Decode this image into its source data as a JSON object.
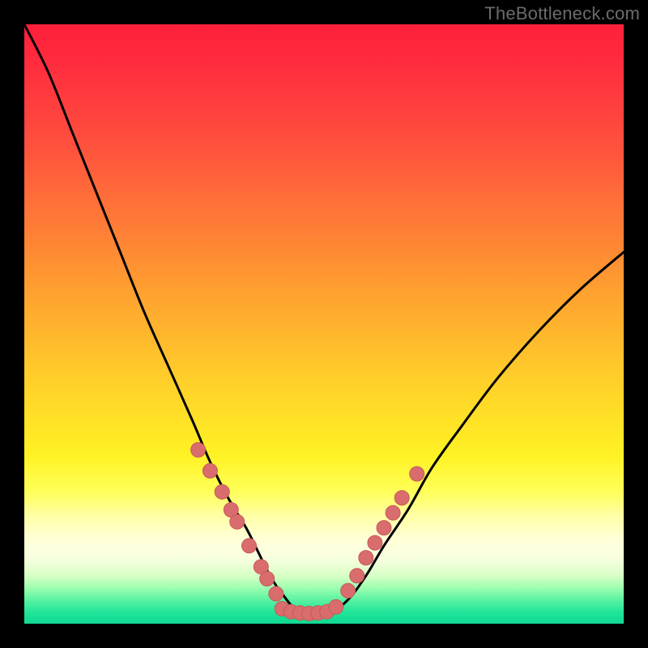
{
  "watermark": "TheBottleneck.com",
  "colors": {
    "curve": "#000000",
    "marker_fill": "#d96c6c",
    "marker_stroke": "#c85a5a"
  },
  "chart_data": {
    "type": "line",
    "title": "",
    "xlabel": "",
    "ylabel": "",
    "xlim": [
      0,
      100
    ],
    "ylim": [
      0,
      100
    ],
    "grid": false,
    "legend": false,
    "annotations": [
      {
        "text": "TheBottleneck.com",
        "pos": "top-right"
      }
    ],
    "series": [
      {
        "name": "curve",
        "x": [
          0,
          4,
          8,
          12,
          16,
          20,
          24,
          28,
          31,
          34,
          37,
          39,
          41,
          43,
          46,
          51,
          54,
          57,
          60,
          64,
          68,
          73,
          79,
          86,
          93,
          100
        ],
        "y": [
          100,
          92,
          82,
          72,
          62,
          52,
          43,
          34,
          27,
          21,
          16,
          12,
          8,
          5,
          2,
          2,
          4,
          8,
          13,
          19,
          26,
          33,
          41,
          49,
          56,
          62
        ]
      }
    ],
    "markers": [
      {
        "x": 29.0,
        "y": 29.0
      },
      {
        "x": 31.0,
        "y": 25.5
      },
      {
        "x": 33.0,
        "y": 22.0
      },
      {
        "x": 34.5,
        "y": 19.0
      },
      {
        "x": 35.5,
        "y": 17.0
      },
      {
        "x": 37.5,
        "y": 13.0
      },
      {
        "x": 39.5,
        "y": 9.5
      },
      {
        "x": 40.5,
        "y": 7.5
      },
      {
        "x": 42.0,
        "y": 5.0
      },
      {
        "x": 43.0,
        "y": 2.5
      },
      {
        "x": 44.5,
        "y": 2.0
      },
      {
        "x": 46.0,
        "y": 1.8
      },
      {
        "x": 47.5,
        "y": 1.7
      },
      {
        "x": 49.0,
        "y": 1.8
      },
      {
        "x": 50.5,
        "y": 2.0
      },
      {
        "x": 52.0,
        "y": 2.8
      },
      {
        "x": 54.0,
        "y": 5.5
      },
      {
        "x": 55.5,
        "y": 8.0
      },
      {
        "x": 57.0,
        "y": 11.0
      },
      {
        "x": 58.5,
        "y": 13.5
      },
      {
        "x": 60.0,
        "y": 16.0
      },
      {
        "x": 61.5,
        "y": 18.5
      },
      {
        "x": 63.0,
        "y": 21.0
      },
      {
        "x": 65.5,
        "y": 25.0
      }
    ]
  }
}
